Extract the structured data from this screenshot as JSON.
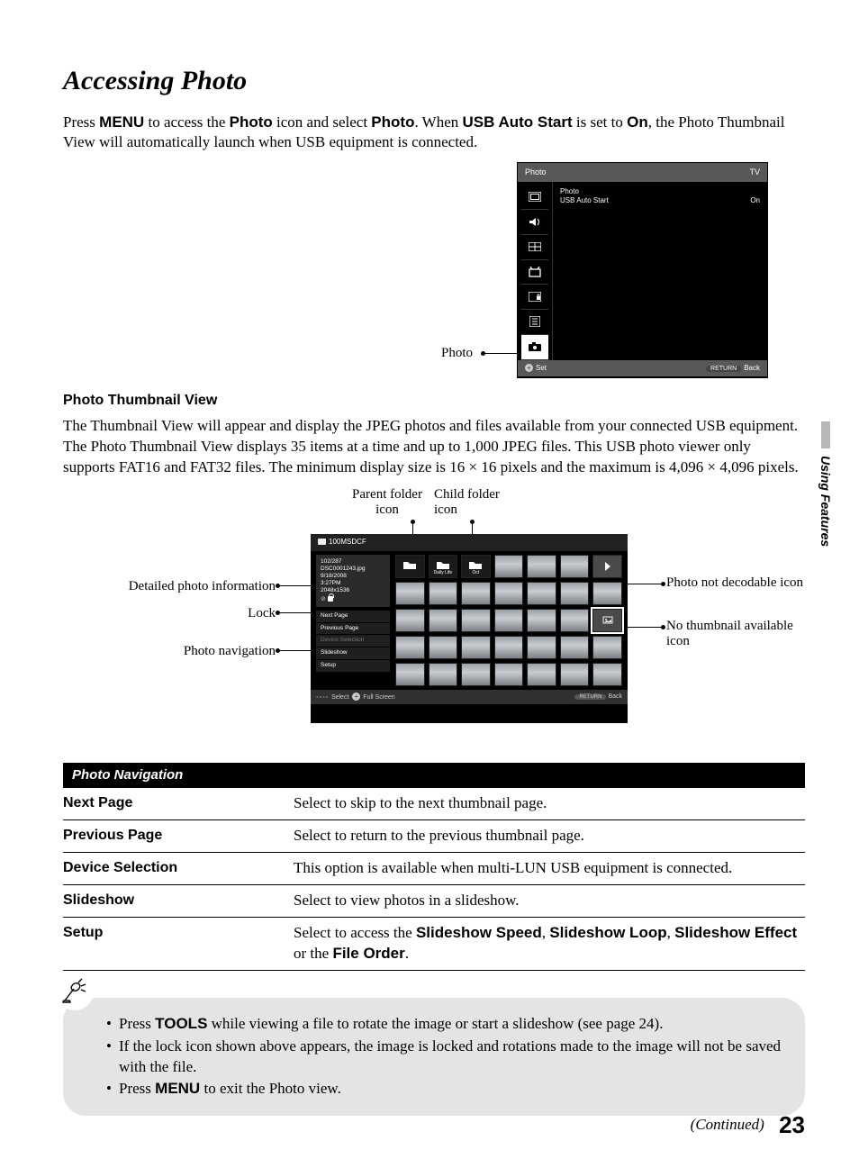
{
  "page": {
    "section_title": "Accessing Photo",
    "intro_tokens": [
      "Press ",
      "MENU",
      " to access the ",
      "Photo",
      " icon and select ",
      "Photo",
      ". When ",
      "USB Auto Start",
      " is set to ",
      "On",
      ", the Photo Thumbnail View will automatically launch when USB equipment is connected."
    ],
    "side_tab": "Using Features",
    "menu_callout": "Photo",
    "menu_screen": {
      "title_left": "Photo",
      "title_right": "TV",
      "opt1": "Photo",
      "opt2": "USB Auto Start",
      "opt2_value": "On",
      "footer_set": "Set",
      "footer_return": "RETURN",
      "footer_back": "Back"
    },
    "subhead1": "Photo Thumbnail View",
    "thumb_para": "The Thumbnail View will appear and display the JPEG photos and files available from your connected USB equipment. The Photo Thumbnail View displays 35 items at a time and up to 1,000 JPEG files. This USB photo viewer only supports FAT16 and FAT32 files. The minimum display size is 16 × 16 pixels and the maximum is 4,096 × 4,096 pixels.",
    "callouts": {
      "parent_folder": "Parent folder icon",
      "child_folder": "Child folder icon",
      "detail_info": "Detailed photo information",
      "lock": "Lock",
      "nav": "Photo navigation",
      "not_decodable": "Photo not decodable icon",
      "no_thumb": "No thumbnail available icon"
    },
    "tv": {
      "path": "100MSDCF",
      "info": {
        "counter": "102/287",
        "filename": "DSC0001243.jpg",
        "date": "9/18/2008",
        "time": "3:27PM",
        "res": "2048x1536"
      },
      "folder1": "Daily Life",
      "folder2": "Oct",
      "nav_items": [
        "Next Page",
        "Previous Page",
        "Device Selection",
        "Slideshow",
        "Setup"
      ],
      "footer_select": "Select",
      "footer_full": "Full Screen",
      "footer_return": "RETURN",
      "footer_back": "Back"
    },
    "table": {
      "header": "Photo Navigation",
      "rows": [
        {
          "k": "Next Page",
          "v": "Select to skip to the next thumbnail page."
        },
        {
          "k": "Previous Page",
          "v": "Select to return to the previous thumbnail page."
        },
        {
          "k": "Device Selection",
          "v": "This option is available when multi-LUN USB equipment is connected."
        },
        {
          "k": "Slideshow",
          "v": "Select to view photos in a slideshow."
        }
      ],
      "setup_k": "Setup",
      "setup_tokens": [
        "Select to access the ",
        "Slideshow Speed",
        ", ",
        "Slideshow Loop",
        ", ",
        "Slideshow Effect",
        " or the ",
        "File Order",
        "."
      ]
    },
    "tips": {
      "t1": [
        "Press ",
        "TOOLS",
        " while viewing a file to rotate the image or start a slideshow (see page 24)."
      ],
      "t2": "If the lock icon shown above appears, the image is locked and rotations made to the image will not be saved with the file.",
      "t3": [
        "Press ",
        "MENU",
        " to exit the Photo view."
      ]
    },
    "continued": "(Continued)",
    "page_number": "23"
  }
}
